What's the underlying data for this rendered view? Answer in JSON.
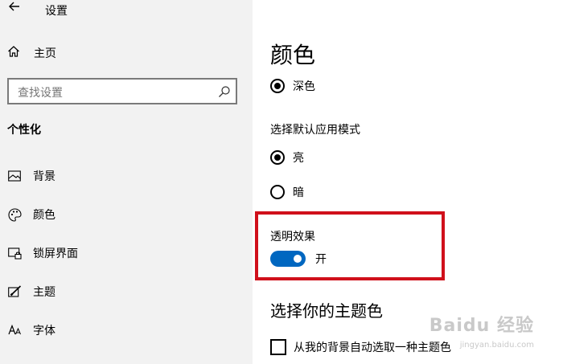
{
  "window": {
    "title": "设置"
  },
  "sidebar": {
    "home_label": "主页",
    "search_placeholder": "查找设置",
    "section_title": "个性化",
    "items": [
      {
        "label": "背景",
        "icon": "image-icon"
      },
      {
        "label": "颜色",
        "icon": "palette-icon"
      },
      {
        "label": "锁屏界面",
        "icon": "lock-screen-icon"
      },
      {
        "label": "主题",
        "icon": "theme-brush-icon"
      },
      {
        "label": "字体",
        "icon": "font-icon"
      }
    ]
  },
  "main": {
    "title": "颜色",
    "color_choice": {
      "label": "深色",
      "selected": true
    },
    "app_mode": {
      "label": "选择默认应用模式",
      "options": [
        {
          "label": "亮",
          "selected": true
        },
        {
          "label": "暗",
          "selected": false
        }
      ]
    },
    "transparency": {
      "label": "透明效果",
      "state_label": "开",
      "on": true
    },
    "accent_section": {
      "title": "选择你的主题色",
      "auto_checkbox_label": "从我的背景自动选取一种主题色",
      "auto_checked": false
    }
  },
  "watermark": {
    "text": "Baidu 经验",
    "sub": "jingyan.baidu.com"
  },
  "colors": {
    "accent": "#0067c0",
    "highlight": "#d0101b",
    "sidebar_bg": "#f2f2f2"
  }
}
